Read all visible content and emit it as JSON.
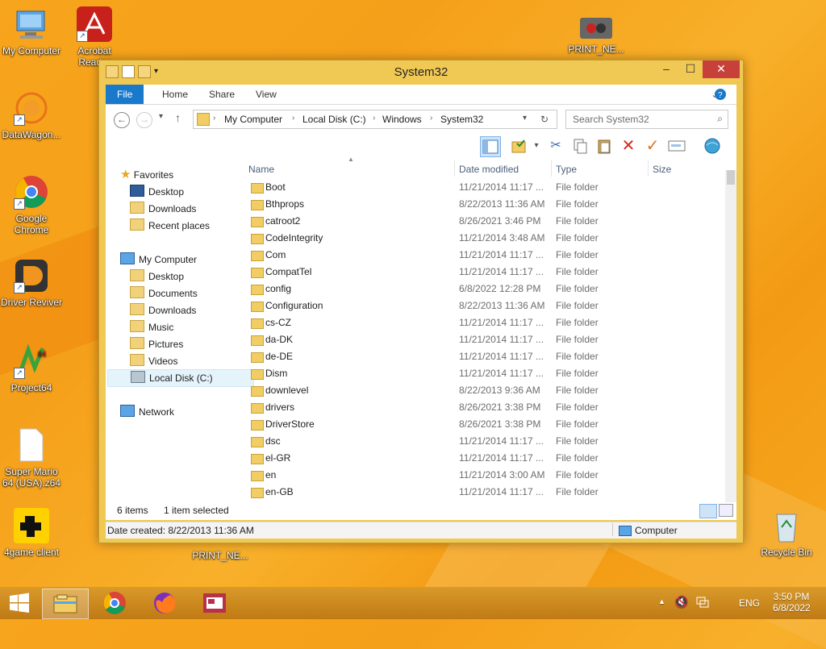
{
  "desktop": {
    "icons": [
      {
        "label": "My Computer"
      },
      {
        "label": "Acrobat Reader"
      },
      {
        "label": "PRINT_NE..."
      },
      {
        "label": "DataWagon..."
      },
      {
        "label": "Google Chrome"
      },
      {
        "label": "Driver Reviver"
      },
      {
        "label": "Project64"
      },
      {
        "label": "Super Mario 64 (USA).z64"
      },
      {
        "label": "4game client"
      },
      {
        "label": "PRINT_NE..."
      },
      {
        "label": "Recycle Bin"
      }
    ]
  },
  "window": {
    "title": "System32",
    "tabs": [
      "File",
      "Home",
      "Share",
      "View"
    ],
    "breadcrumb": [
      "My Computer",
      "Local Disk (C:)",
      "Windows",
      "System32"
    ],
    "search_placeholder": "Search System32",
    "nav": {
      "favorites": "Favorites",
      "fav_items": [
        "Desktop",
        "Downloads",
        "Recent places"
      ],
      "computer": "My Computer",
      "comp_items": [
        "Desktop",
        "Documents",
        "Downloads",
        "Music",
        "Pictures",
        "Videos",
        "Local Disk (C:)"
      ],
      "network": "Network"
    },
    "columns": [
      "Name",
      "Date modified",
      "Type",
      "Size"
    ],
    "files": [
      {
        "name": "Boot",
        "date": "11/21/2014 11:17 ...",
        "type": "File folder"
      },
      {
        "name": "Bthprops",
        "date": "8/22/2013 11:36 AM",
        "type": "File folder"
      },
      {
        "name": "catroot2",
        "date": "8/26/2021 3:46 PM",
        "type": "File folder"
      },
      {
        "name": "CodeIntegrity",
        "date": "11/21/2014 3:48 AM",
        "type": "File folder"
      },
      {
        "name": "Com",
        "date": "11/21/2014 11:17 ...",
        "type": "File folder"
      },
      {
        "name": "CompatTel",
        "date": "11/21/2014 11:17 ...",
        "type": "File folder"
      },
      {
        "name": "config",
        "date": "6/8/2022 12:28 PM",
        "type": "File folder"
      },
      {
        "name": "Configuration",
        "date": "8/22/2013 11:36 AM",
        "type": "File folder"
      },
      {
        "name": "cs-CZ",
        "date": "11/21/2014 11:17 ...",
        "type": "File folder"
      },
      {
        "name": "da-DK",
        "date": "11/21/2014 11:17 ...",
        "type": "File folder"
      },
      {
        "name": "de-DE",
        "date": "11/21/2014 11:17 ...",
        "type": "File folder"
      },
      {
        "name": "Dism",
        "date": "11/21/2014 11:17 ...",
        "type": "File folder"
      },
      {
        "name": "downlevel",
        "date": "8/22/2013 9:36 AM",
        "type": "File folder"
      },
      {
        "name": "drivers",
        "date": "8/26/2021 3:38 PM",
        "type": "File folder"
      },
      {
        "name": "DriverStore",
        "date": "8/26/2021 3:38 PM",
        "type": "File folder"
      },
      {
        "name": "dsc",
        "date": "11/21/2014 11:17 ...",
        "type": "File folder"
      },
      {
        "name": "el-GR",
        "date": "11/21/2014 11:17 ...",
        "type": "File folder"
      },
      {
        "name": "en",
        "date": "11/21/2014 3:00 AM",
        "type": "File folder"
      },
      {
        "name": "en-GB",
        "date": "11/21/2014 11:17 ...",
        "type": "File folder"
      }
    ],
    "status": {
      "items": "6 items",
      "selected": "1 item selected",
      "date_created": "Date created: 8/22/2013 11:36 AM",
      "location": "Computer"
    }
  },
  "taskbar": {
    "lang": "ENG",
    "time": "3:50 PM",
    "date": "6/8/2022"
  }
}
